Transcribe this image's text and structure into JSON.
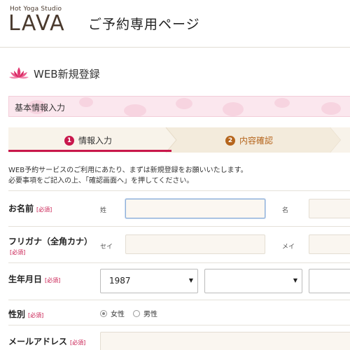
{
  "header": {
    "logo_sub": "Hot Yoga Studio",
    "logo_main": "LAVA",
    "title": "ご予約専用ページ"
  },
  "section": {
    "title": "WEB新規登録"
  },
  "info_bar": {
    "text": "基本情報入力"
  },
  "steps": [
    {
      "number": "1",
      "label": "情報入力",
      "state": "active",
      "color": "#c8174c"
    },
    {
      "number": "2",
      "label": "内容確認",
      "state": "inactive",
      "color": "#b5651d"
    }
  ],
  "intro": {
    "line1": "WEB予約サービスのご利用にあたり、まずは新規登録をお願いいたします。",
    "line2": "必要事項をご記入の上、「確認画面へ」を押してください。"
  },
  "form": {
    "required_label": "[必須]",
    "name": {
      "label": "お名前",
      "last_sublabel": "姓",
      "first_sublabel": "名",
      "last_value": "",
      "first_value": ""
    },
    "kana": {
      "label": "フリガナ（全角カナ）",
      "last_sublabel": "セイ",
      "first_sublabel": "メイ",
      "last_value": "",
      "first_value": ""
    },
    "birthdate": {
      "label": "生年月日",
      "year_value": "1987",
      "month_value": "",
      "day_value": ""
    },
    "gender": {
      "label": "性別",
      "options": [
        "女性",
        "男性"
      ],
      "selected": "女性"
    },
    "email": {
      "label": "メールアドレス",
      "value": ""
    }
  },
  "colors": {
    "accent": "#c8174c",
    "brand_brown": "#4a3a2e",
    "step_inactive": "#b5651d",
    "pink_bar": "#fbe7ee",
    "input_bg": "#faf6f0"
  }
}
